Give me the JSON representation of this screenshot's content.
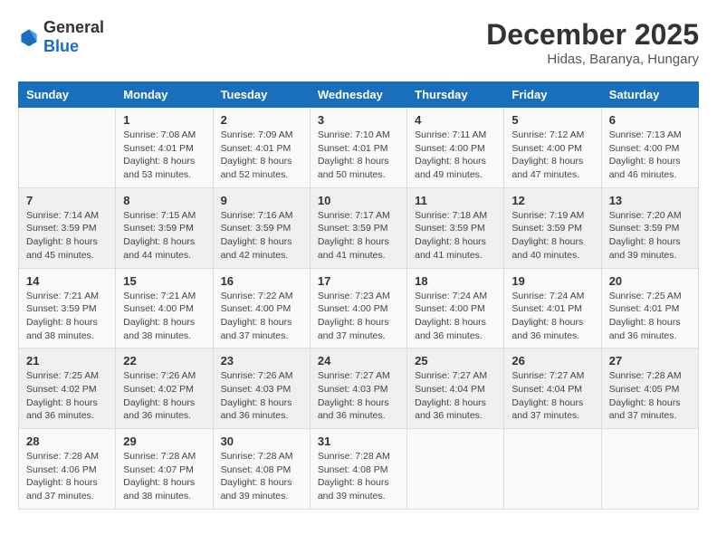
{
  "logo": {
    "general": "General",
    "blue": "Blue"
  },
  "title": "December 2025",
  "subtitle": "Hidas, Baranya, Hungary",
  "weekdays": [
    "Sunday",
    "Monday",
    "Tuesday",
    "Wednesday",
    "Thursday",
    "Friday",
    "Saturday"
  ],
  "weeks": [
    [
      null,
      {
        "day": 1,
        "sunrise": "7:08 AM",
        "sunset": "4:01 PM",
        "daylight": "8 hours and 53 minutes."
      },
      {
        "day": 2,
        "sunrise": "7:09 AM",
        "sunset": "4:01 PM",
        "daylight": "8 hours and 52 minutes."
      },
      {
        "day": 3,
        "sunrise": "7:10 AM",
        "sunset": "4:01 PM",
        "daylight": "8 hours and 50 minutes."
      },
      {
        "day": 4,
        "sunrise": "7:11 AM",
        "sunset": "4:00 PM",
        "daylight": "8 hours and 49 minutes."
      },
      {
        "day": 5,
        "sunrise": "7:12 AM",
        "sunset": "4:00 PM",
        "daylight": "8 hours and 47 minutes."
      },
      {
        "day": 6,
        "sunrise": "7:13 AM",
        "sunset": "4:00 PM",
        "daylight": "8 hours and 46 minutes."
      }
    ],
    [
      {
        "day": 7,
        "sunrise": "7:14 AM",
        "sunset": "3:59 PM",
        "daylight": "8 hours and 45 minutes."
      },
      {
        "day": 8,
        "sunrise": "7:15 AM",
        "sunset": "3:59 PM",
        "daylight": "8 hours and 44 minutes."
      },
      {
        "day": 9,
        "sunrise": "7:16 AM",
        "sunset": "3:59 PM",
        "daylight": "8 hours and 42 minutes."
      },
      {
        "day": 10,
        "sunrise": "7:17 AM",
        "sunset": "3:59 PM",
        "daylight": "8 hours and 41 minutes."
      },
      {
        "day": 11,
        "sunrise": "7:18 AM",
        "sunset": "3:59 PM",
        "daylight": "8 hours and 41 minutes."
      },
      {
        "day": 12,
        "sunrise": "7:19 AM",
        "sunset": "3:59 PM",
        "daylight": "8 hours and 40 minutes."
      },
      {
        "day": 13,
        "sunrise": "7:20 AM",
        "sunset": "3:59 PM",
        "daylight": "8 hours and 39 minutes."
      }
    ],
    [
      {
        "day": 14,
        "sunrise": "7:21 AM",
        "sunset": "3:59 PM",
        "daylight": "8 hours and 38 minutes."
      },
      {
        "day": 15,
        "sunrise": "7:21 AM",
        "sunset": "4:00 PM",
        "daylight": "8 hours and 38 minutes."
      },
      {
        "day": 16,
        "sunrise": "7:22 AM",
        "sunset": "4:00 PM",
        "daylight": "8 hours and 37 minutes."
      },
      {
        "day": 17,
        "sunrise": "7:23 AM",
        "sunset": "4:00 PM",
        "daylight": "8 hours and 37 minutes."
      },
      {
        "day": 18,
        "sunrise": "7:24 AM",
        "sunset": "4:00 PM",
        "daylight": "8 hours and 36 minutes."
      },
      {
        "day": 19,
        "sunrise": "7:24 AM",
        "sunset": "4:01 PM",
        "daylight": "8 hours and 36 minutes."
      },
      {
        "day": 20,
        "sunrise": "7:25 AM",
        "sunset": "4:01 PM",
        "daylight": "8 hours and 36 minutes."
      }
    ],
    [
      {
        "day": 21,
        "sunrise": "7:25 AM",
        "sunset": "4:02 PM",
        "daylight": "8 hours and 36 minutes."
      },
      {
        "day": 22,
        "sunrise": "7:26 AM",
        "sunset": "4:02 PM",
        "daylight": "8 hours and 36 minutes."
      },
      {
        "day": 23,
        "sunrise": "7:26 AM",
        "sunset": "4:03 PM",
        "daylight": "8 hours and 36 minutes."
      },
      {
        "day": 24,
        "sunrise": "7:27 AM",
        "sunset": "4:03 PM",
        "daylight": "8 hours and 36 minutes."
      },
      {
        "day": 25,
        "sunrise": "7:27 AM",
        "sunset": "4:04 PM",
        "daylight": "8 hours and 36 minutes."
      },
      {
        "day": 26,
        "sunrise": "7:27 AM",
        "sunset": "4:04 PM",
        "daylight": "8 hours and 37 minutes."
      },
      {
        "day": 27,
        "sunrise": "7:28 AM",
        "sunset": "4:05 PM",
        "daylight": "8 hours and 37 minutes."
      }
    ],
    [
      {
        "day": 28,
        "sunrise": "7:28 AM",
        "sunset": "4:06 PM",
        "daylight": "8 hours and 37 minutes."
      },
      {
        "day": 29,
        "sunrise": "7:28 AM",
        "sunset": "4:07 PM",
        "daylight": "8 hours and 38 minutes."
      },
      {
        "day": 30,
        "sunrise": "7:28 AM",
        "sunset": "4:08 PM",
        "daylight": "8 hours and 39 minutes."
      },
      {
        "day": 31,
        "sunrise": "7:28 AM",
        "sunset": "4:08 PM",
        "daylight": "8 hours and 39 minutes."
      },
      null,
      null,
      null
    ]
  ]
}
